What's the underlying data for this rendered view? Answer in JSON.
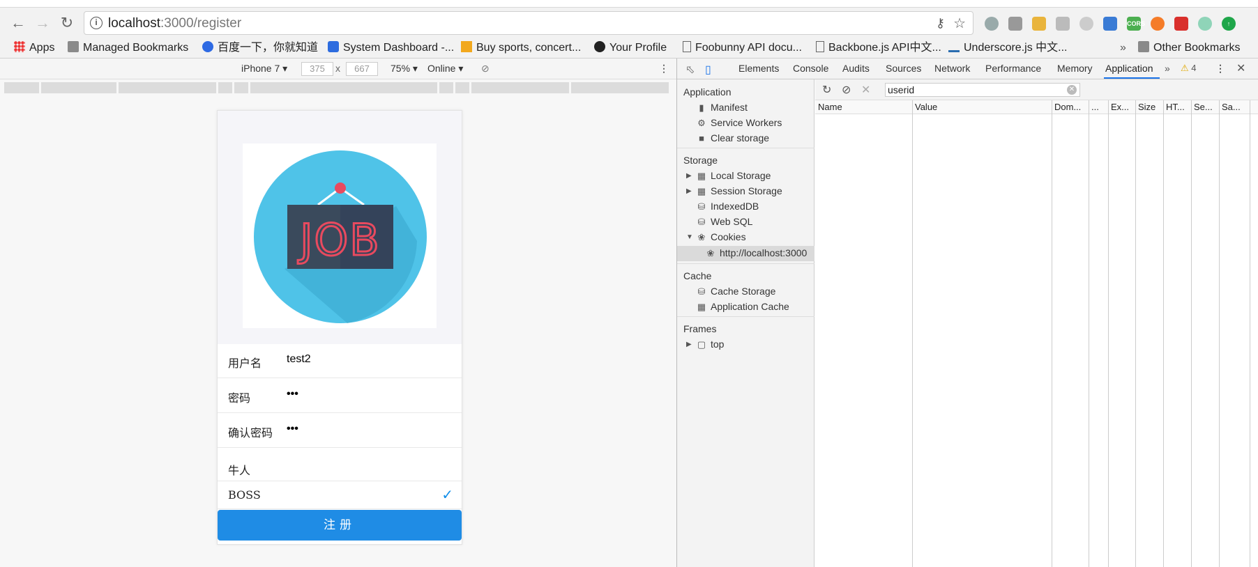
{
  "browser": {
    "url_host": "localhost",
    "url_path": ":3000/register",
    "bookmarks": [
      {
        "label": "Apps",
        "icon": "apps-grid-icon"
      },
      {
        "label": "Managed Bookmarks",
        "icon": "folder-icon"
      },
      {
        "label": "百度一下，你就知道",
        "icon": "baidu-paw-icon"
      },
      {
        "label": "System Dashboard -...",
        "icon": "jira-icon"
      },
      {
        "label": "Buy sports, concert...",
        "icon": "ticket-icon"
      },
      {
        "label": "Your Profile",
        "icon": "github-icon"
      },
      {
        "label": "Foobunny API docu...",
        "icon": "page-icon"
      },
      {
        "label": "Backbone.js API中文...",
        "icon": "page-icon"
      },
      {
        "label": "Underscore.js 中文...",
        "icon": "underscore-icon"
      },
      {
        "label": "Other Bookmarks",
        "icon": "folder-icon"
      }
    ],
    "overflow_label": "»"
  },
  "device_toolbar": {
    "device": "iPhone 7",
    "width": "375",
    "height": "667",
    "times": "x",
    "zoom": "75%",
    "network": "Online"
  },
  "phone": {
    "logo_text": "JOB",
    "fields": [
      {
        "label": "用户名",
        "value": "test2"
      },
      {
        "label": "密码",
        "value": "•••"
      },
      {
        "label": "确认密码",
        "value": "•••"
      }
    ],
    "roles": [
      {
        "label": "牛人",
        "checked": false
      },
      {
        "label": "BOSS",
        "checked": true
      }
    ],
    "submit_label": "注册"
  },
  "devtools": {
    "tabs": [
      "Elements",
      "Console",
      "Audits",
      "Sources",
      "Network",
      "Performance",
      "Memory",
      "Application"
    ],
    "active_tab": "Application",
    "warning_count": "4",
    "sidebar": {
      "application_head": "Application",
      "application_items": [
        "Manifest",
        "Service Workers",
        "Clear storage"
      ],
      "storage_head": "Storage",
      "storage_items": [
        "Local Storage",
        "Session Storage",
        "IndexedDB",
        "Web SQL",
        "Cookies",
        "http://localhost:3000"
      ],
      "cache_head": "Cache",
      "cache_items": [
        "Cache Storage",
        "Application Cache"
      ],
      "frames_head": "Frames",
      "frames_items": [
        "top"
      ]
    },
    "filter_value": "userid",
    "columns": [
      "Name",
      "Value",
      "Dom...",
      "...",
      "Ex...",
      "Size",
      "HT...",
      "Se...",
      "Sa..."
    ]
  },
  "colors": {
    "accent": "#1f8ce5",
    "check": "#108ee9",
    "logo_circle": "#4fc3e8",
    "sign": "#3a4a5c",
    "sign_text": "#e84a5f"
  }
}
